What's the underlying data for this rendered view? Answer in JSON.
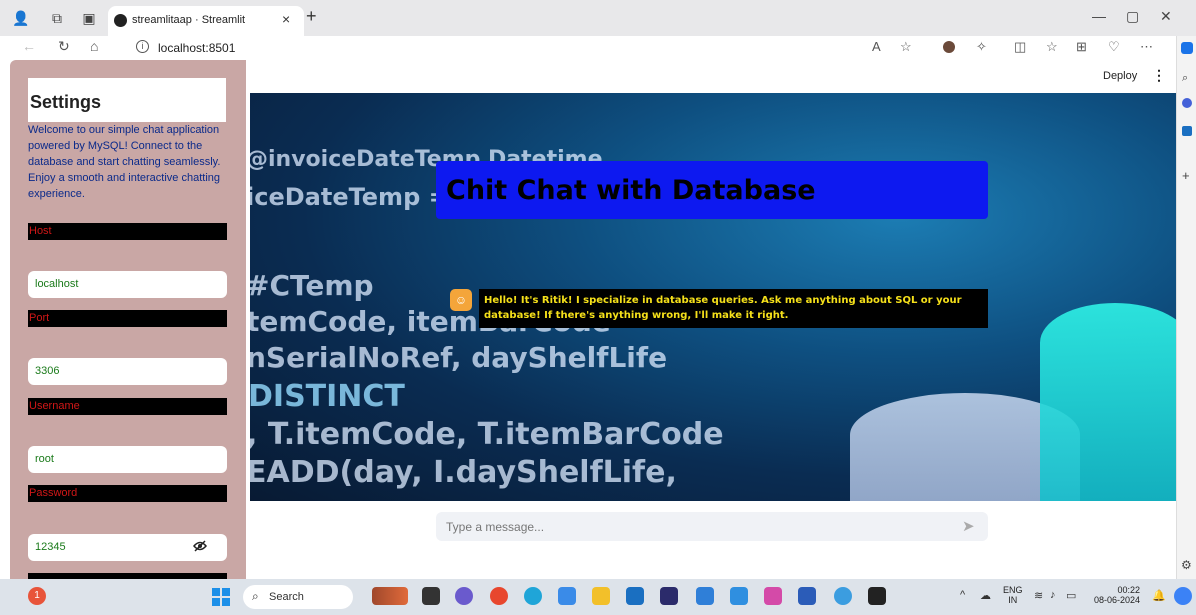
{
  "browser": {
    "tab_title": "streamlitaap · Streamlit",
    "tab_close": "×",
    "new_tab": "+",
    "url": "localhost:8501",
    "window_controls": [
      "—",
      "▢",
      "✕"
    ]
  },
  "app": {
    "deploy_label": "Deploy",
    "menu_icon": "⋮"
  },
  "sidebar": {
    "title": "Settings",
    "welcome": "Welcome to our simple chat application powered by MySQL! Connect to the database and start chatting seamlessly. Enjoy a smooth and interactive chatting experience.",
    "fields": {
      "host": {
        "label": "Host",
        "value": "localhost"
      },
      "port": {
        "label": "Port",
        "value": "3306"
      },
      "username": {
        "label": "Username",
        "value": "root"
      },
      "password": {
        "label": "Password",
        "value": "12345"
      }
    }
  },
  "main": {
    "title": "Chit Chat with Database",
    "bot_message": "Hello! It's Ritik! I specialize in database queries. Ask me anything about SQL or your database! If there's anything wrong, I'll make it right.",
    "input_placeholder": "Type a message...",
    "background_code": [
      "@invoiceDateTemp Datetime",
      "iceDateTemp = CONVERT",
      "#CTemp",
      "temCode, itemBarCode",
      "nSerialNoRef, dayShelfLife",
      "DISTINCT",
      ", T.itemCode, T.itemBarCode",
      "EADD(day, I.dayShelfLife,"
    ]
  },
  "taskbar": {
    "search_label": "Search",
    "lang_top": "ENG",
    "lang_bottom": "IN",
    "time": "00:22",
    "date": "08-06-2024",
    "notification_count": "1"
  },
  "colors": {
    "sidebar_bg": "#c9a7a5",
    "title_box": "#0d19f0",
    "message_text": "#f5e01a",
    "field_label_text": "#d01717",
    "field_value_text": "#1a7a1a"
  }
}
